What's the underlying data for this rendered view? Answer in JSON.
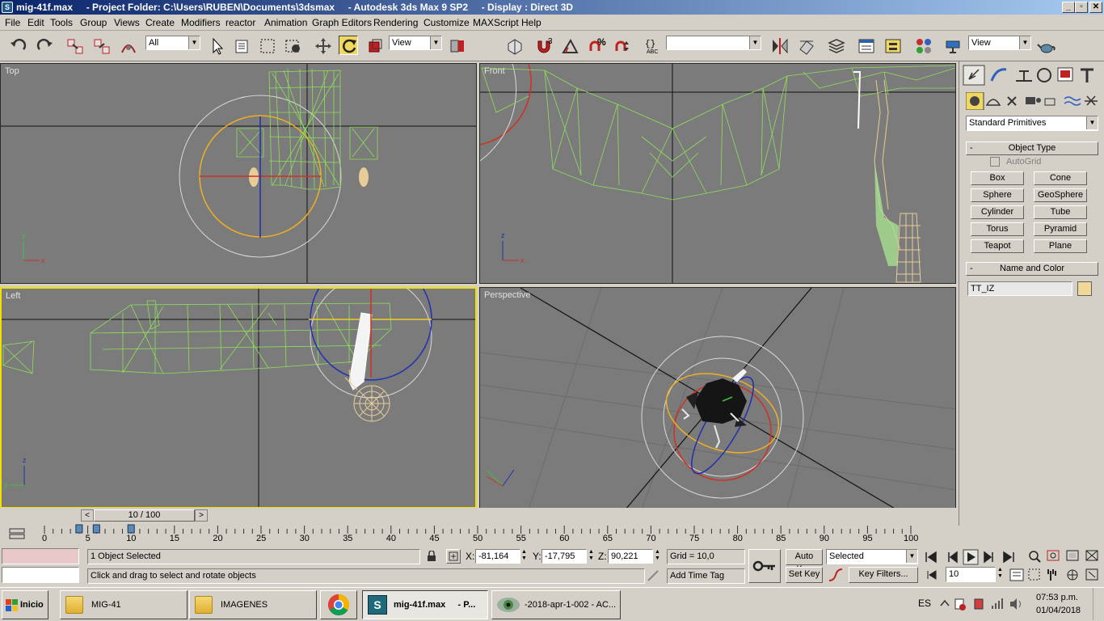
{
  "window": {
    "title": "mig-41f.max     - Project Folder: C:\\Users\\RUBEN\\Documents\\3dsmax     - Autodesk 3ds Max 9 SP2     - Display : Direct 3D",
    "minimize": "_",
    "maximize": "▫",
    "close": "✕"
  },
  "menu": [
    "File",
    "Edit",
    "Tools",
    "Group",
    "Views",
    "Create",
    "Modifiers",
    "reactor",
    "Animation",
    "Graph Editors",
    "Rendering",
    "Customize",
    "MAXScript",
    "Help"
  ],
  "toolbar": {
    "selection_filter": "All",
    "ref_coord": "View",
    "named_selection": "",
    "view_dropdown": "View",
    "snap_3_label": "3",
    "percent_label": "%"
  },
  "viewports": {
    "top": "Top",
    "front": "Front",
    "left": "Left",
    "perspective": "Perspective"
  },
  "command_panel": {
    "category": "Standard Primitives",
    "object_type_title": "Object Type",
    "autogrid": "AutoGrid",
    "buttons": [
      "Box",
      "Cone",
      "Sphere",
      "GeoSphere",
      "Cylinder",
      "Tube",
      "Torus",
      "Pyramid",
      "Teapot",
      "Plane"
    ],
    "name_color_title": "Name and Color",
    "object_name": "TT_IZ",
    "object_color": "#f0d898"
  },
  "timeline": {
    "frame": "10 / 100",
    "ticks": [
      "0",
      "5",
      "10",
      "15",
      "20",
      "25",
      "30",
      "35",
      "40",
      "45",
      "50",
      "55",
      "60",
      "65",
      "70",
      "75",
      "80",
      "85",
      "90",
      "95",
      "100"
    ]
  },
  "status": {
    "selection": "1 Object Selected",
    "prompt": "Click and drag to select and rotate objects",
    "x_label": "X:",
    "x": "-81,164",
    "y_label": "Y:",
    "y": "-17,795",
    "z_label": "Z:",
    "z": "90,221",
    "grid": "Grid = 10,0",
    "add_time_tag": "Add Time Tag",
    "auto_key": "Auto Key",
    "set_key": "Set Key",
    "key_mode": "Selected",
    "key_filters": "Key Filters...",
    "frame_input": "10"
  },
  "taskbar": {
    "start": "Inicio",
    "tasks": [
      "MIG-41",
      "IMAGENES",
      "",
      "mig-41f.max     - P...",
      "-2018-apr-1-002 - AC..."
    ],
    "lang": "ES",
    "time": "07:53 p.m.",
    "date": "01/04/2018"
  },
  "colors": {
    "wire_green": "#8ee05a",
    "wire_tan": "#e8cc98",
    "viewport_bg": "#7b7b7b",
    "active_border": "#f0e000",
    "title_start": "#0a246a"
  }
}
